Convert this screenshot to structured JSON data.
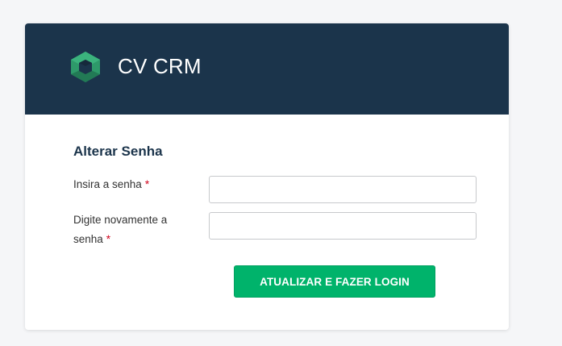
{
  "header": {
    "brand": "CV CRM",
    "logo_icon": "cv-crm-logo-icon",
    "background_color": "#1b344b"
  },
  "form": {
    "title": "Alterar Senha",
    "fields": [
      {
        "label": "Insira a senha",
        "required_mark": "*",
        "value": "",
        "placeholder": ""
      },
      {
        "label": "Digite novamente a senha",
        "required_mark": "*",
        "value": "",
        "placeholder": ""
      }
    ],
    "submit_label": "ATUALIZAR E FAZER LOGIN",
    "accent_color": "#00b36b",
    "required_color": "#d0021b"
  }
}
